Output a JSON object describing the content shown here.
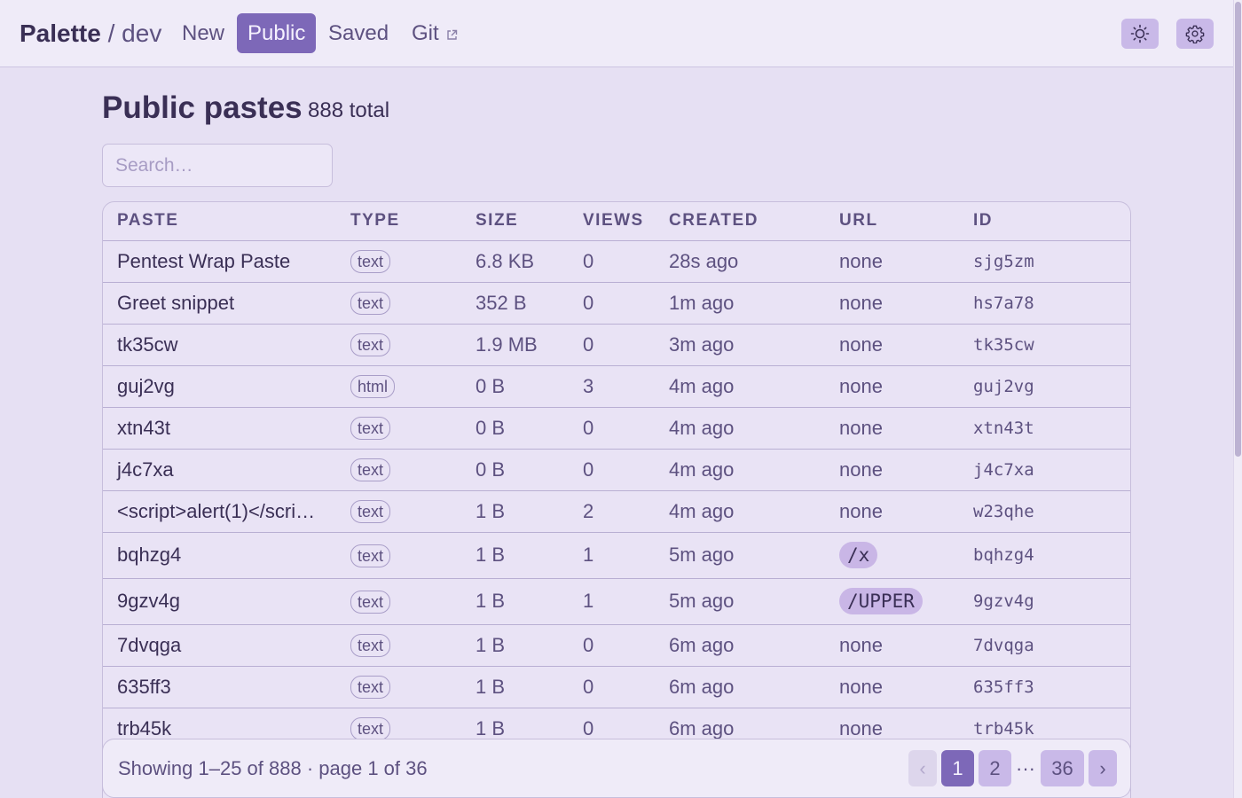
{
  "brand": {
    "name": "Palette",
    "separator": "/",
    "sub": "dev"
  },
  "nav": [
    {
      "label": "New",
      "active": false
    },
    {
      "label": "Public",
      "active": true
    },
    {
      "label": "Saved",
      "active": false
    },
    {
      "label": "Git",
      "active": false,
      "icon": "external-link-icon"
    }
  ],
  "header_actions": [
    {
      "icon": "sun-icon"
    },
    {
      "icon": "gear-icon"
    }
  ],
  "page": {
    "title": "Public pastes",
    "total": "888 total"
  },
  "search": {
    "placeholder": "Search…",
    "value": ""
  },
  "table": {
    "columns": [
      "PASTE",
      "TYPE",
      "SIZE",
      "VIEWS",
      "CREATED",
      "URL",
      "ID"
    ],
    "rows": [
      {
        "title": "Pentest Wrap Paste",
        "type": "text",
        "size": "6.8 KB",
        "views": "0",
        "created": "28s ago",
        "url": "none",
        "id": "sjg5zm"
      },
      {
        "title": "Greet snippet",
        "type": "text",
        "size": "352 B",
        "views": "0",
        "created": "1m ago",
        "url": "none",
        "id": "hs7a78"
      },
      {
        "title": "tk35cw",
        "type": "text",
        "size": "1.9 MB",
        "views": "0",
        "created": "3m ago",
        "url": "none",
        "id": "tk35cw"
      },
      {
        "title": "guj2vg",
        "type": "html",
        "size": "0 B",
        "views": "3",
        "created": "4m ago",
        "url": "none",
        "id": "guj2vg"
      },
      {
        "title": "xtn43t",
        "type": "text",
        "size": "0 B",
        "views": "0",
        "created": "4m ago",
        "url": "none",
        "id": "xtn43t"
      },
      {
        "title": "j4c7xa",
        "type": "text",
        "size": "0 B",
        "views": "0",
        "created": "4m ago",
        "url": "none",
        "id": "j4c7xa"
      },
      {
        "title": "<script>alert(1)</scri…",
        "type": "text",
        "size": "1 B",
        "views": "2",
        "created": "4m ago",
        "url": "none",
        "id": "w23qhe"
      },
      {
        "title": "bqhzg4",
        "type": "text",
        "size": "1 B",
        "views": "1",
        "created": "5m ago",
        "url": "/x",
        "id": "bqhzg4"
      },
      {
        "title": "9gzv4g",
        "type": "text",
        "size": "1 B",
        "views": "1",
        "created": "5m ago",
        "url": "/UPPER",
        "id": "9gzv4g"
      },
      {
        "title": "7dvqga",
        "type": "text",
        "size": "1 B",
        "views": "0",
        "created": "6m ago",
        "url": "none",
        "id": "7dvqga"
      },
      {
        "title": "635ff3",
        "type": "text",
        "size": "1 B",
        "views": "0",
        "created": "6m ago",
        "url": "none",
        "id": "635ff3"
      },
      {
        "title": "trb45k",
        "type": "text",
        "size": "1 B",
        "views": "0",
        "created": "6m ago",
        "url": "none",
        "id": "trb45k"
      }
    ]
  },
  "pagination": {
    "summary": "Showing 1–25 of 888 · page 1 of 36",
    "prev": "‹",
    "pages": [
      "1",
      "2",
      "36"
    ],
    "ellipsis": "···",
    "next": "›",
    "current": "1"
  },
  "colors": {
    "accent": "#7d68b8",
    "background": "#e6e0f3",
    "header": "#efebf8",
    "pill": "#c9b9e8",
    "text": "#3a2f55"
  }
}
